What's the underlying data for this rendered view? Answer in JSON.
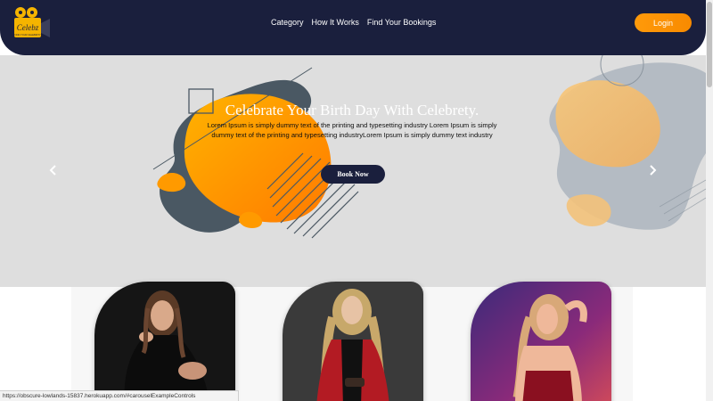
{
  "brand": {
    "logo_text": "Celebz",
    "logo_subtext": "FIND YOUR CELEBRITY"
  },
  "nav": {
    "items": [
      "Category",
      "How It Works",
      "Find Your Bookings"
    ],
    "login_label": "Login"
  },
  "hero": {
    "title": "Celebrate Your Birth Day With Celebrety.",
    "text": "Lorem Ipsum is simply dummy text of the printing and typesetting industry Lorem Ipsum is simply dummy text of the printing and typesetting industryLorem Ipsum is simply dummy text industry",
    "button_label": "Book Now",
    "prev_icon": "chevron-left-icon",
    "next_icon": "chevron-right-icon"
  },
  "cards": [
    {
      "name": "celebrity-card-1"
    },
    {
      "name": "celebrity-card-2"
    },
    {
      "name": "celebrity-card-3"
    }
  ],
  "status_bar": {
    "url": "https://obscure-lowlands-15837.herokuapp.com/#carouselExampleControls"
  },
  "colors": {
    "navy": "#1a1f3d",
    "accent": "#ff9a0a",
    "hero_bg": "#dedede"
  }
}
